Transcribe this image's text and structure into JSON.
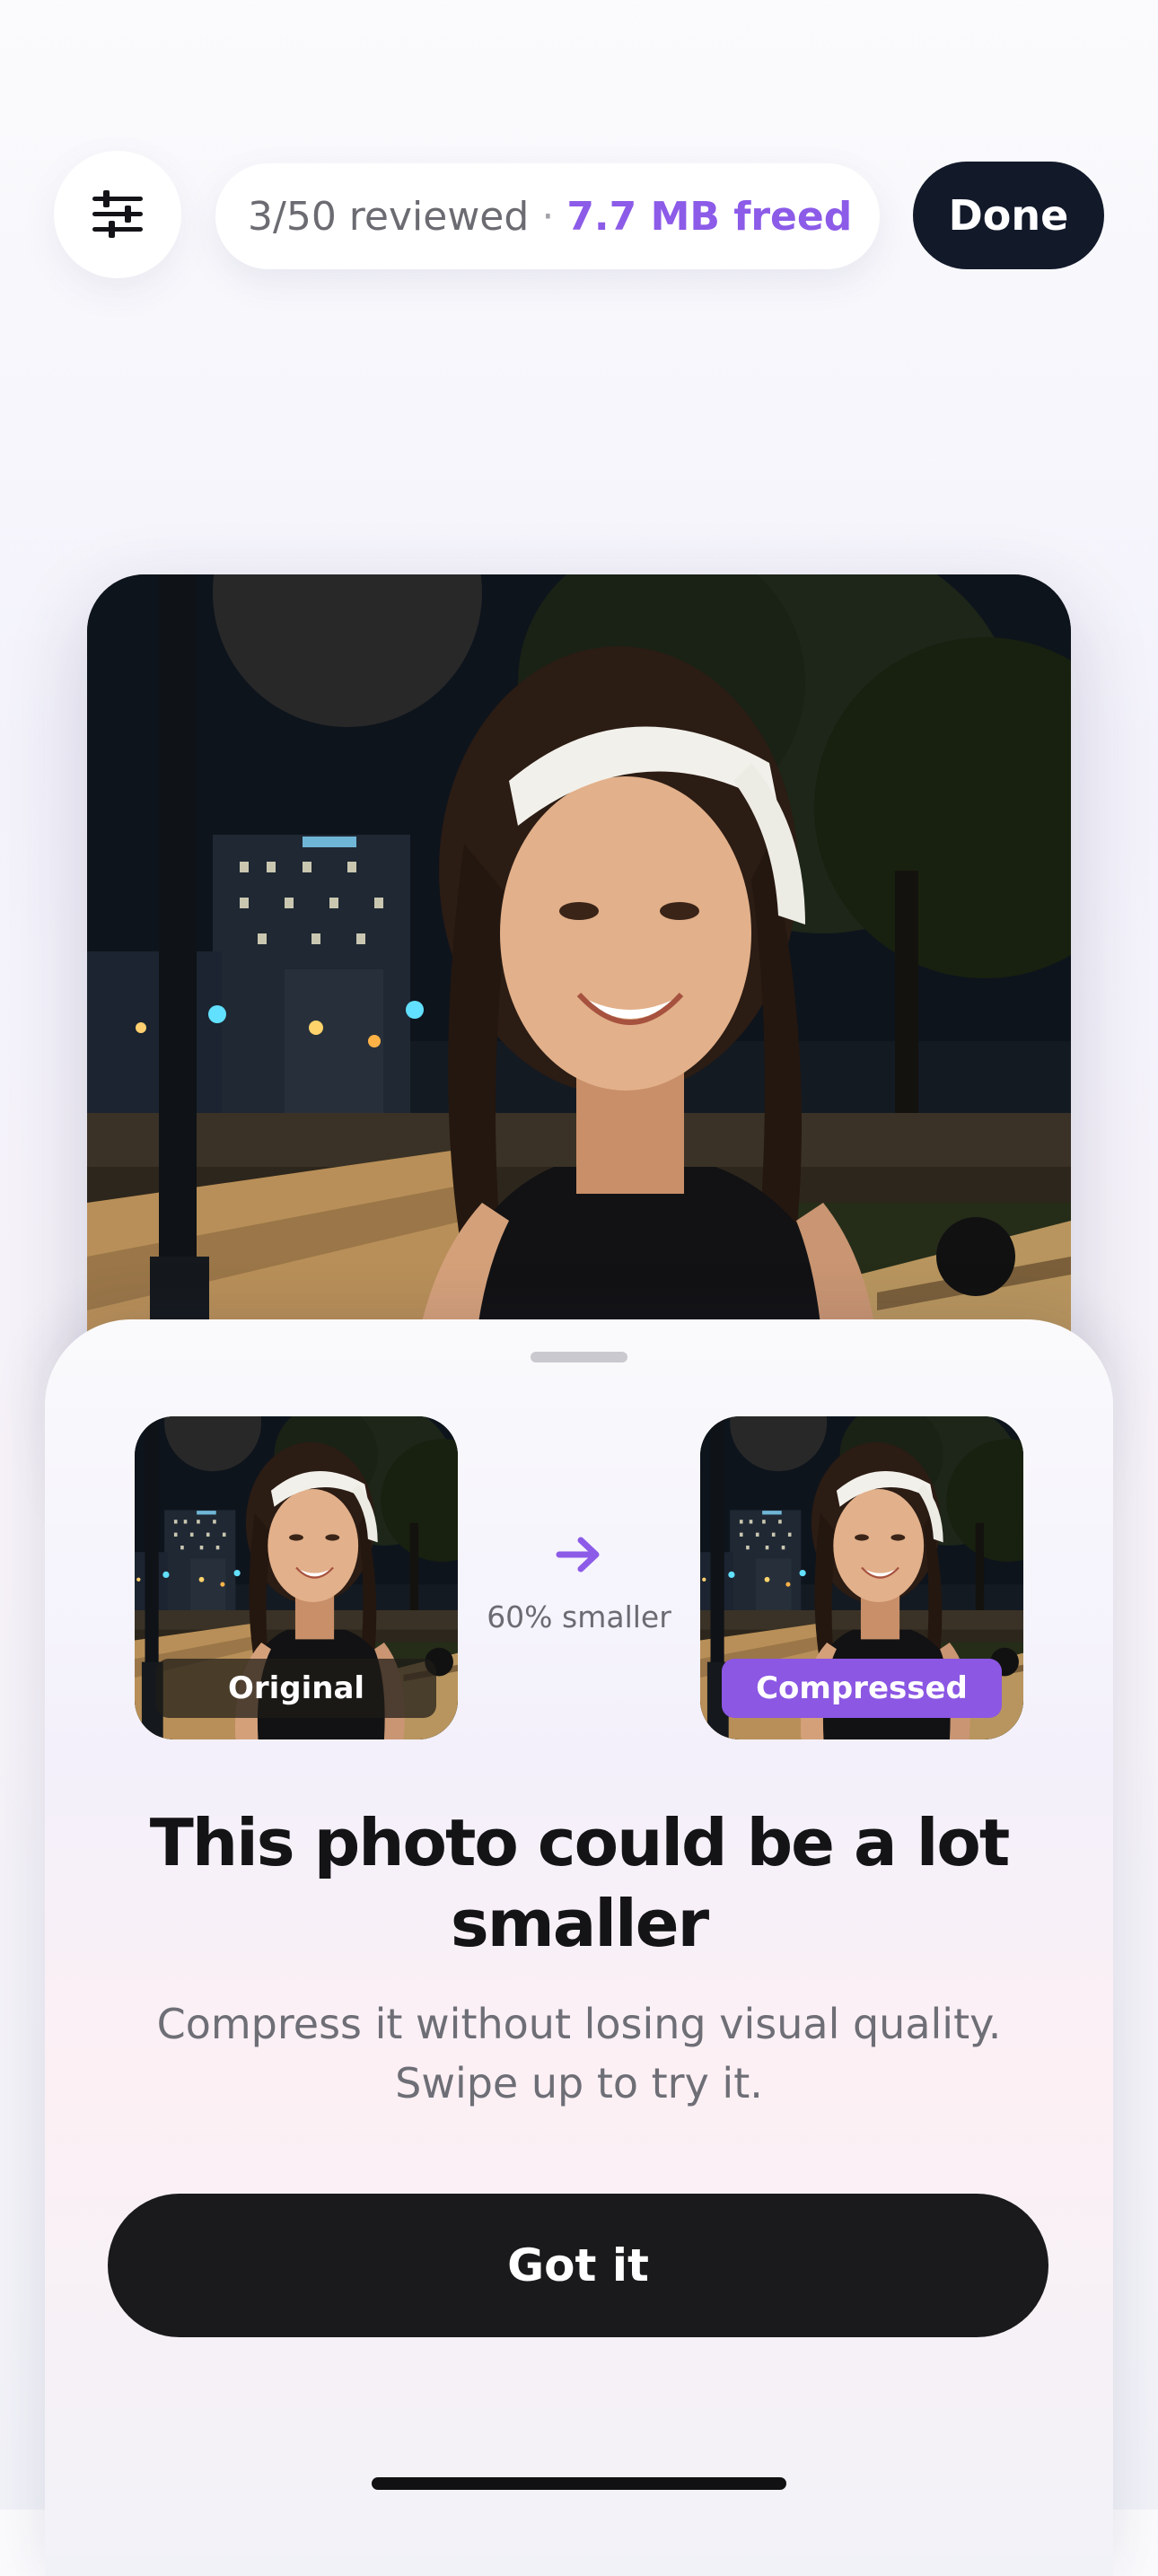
{
  "top_bar": {
    "filter_icon": "sliders-icon",
    "reviewed_text": "3/50 reviewed",
    "separator": "·",
    "freed_text": "7.7 MB freed",
    "done_label": "Done"
  },
  "photo": {
    "description_icon": "night-portrait-photo"
  },
  "sheet": {
    "original_label": "Original",
    "compressed_label": "Compressed",
    "arrow_icon": "arrow-right-icon",
    "size_reduction_text": "60% smaller",
    "headline": "This photo could be a lot smaller",
    "subtext": "Compress it without losing visual quality. Swipe up to try it.",
    "button_label": "Got it"
  },
  "colors": {
    "accent": "#8c5be8",
    "done_button": "#121a2a",
    "primary_button": "#1a1a1c"
  }
}
